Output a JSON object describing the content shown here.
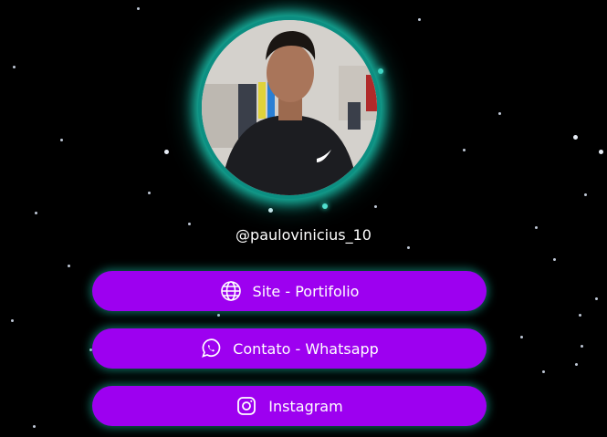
{
  "profile": {
    "handle": "@paulovinicius_10"
  },
  "links": [
    {
      "label": "Site - Portifolio",
      "icon": "globe-icon"
    },
    {
      "label": "Contato - Whatsapp",
      "icon": "whatsapp-icon"
    },
    {
      "label": "Instagram",
      "icon": "instagram-icon"
    }
  ],
  "colors": {
    "background": "#000000",
    "button": "#9d00f0",
    "glow": "#19c2ad",
    "text": "#ffffff"
  }
}
